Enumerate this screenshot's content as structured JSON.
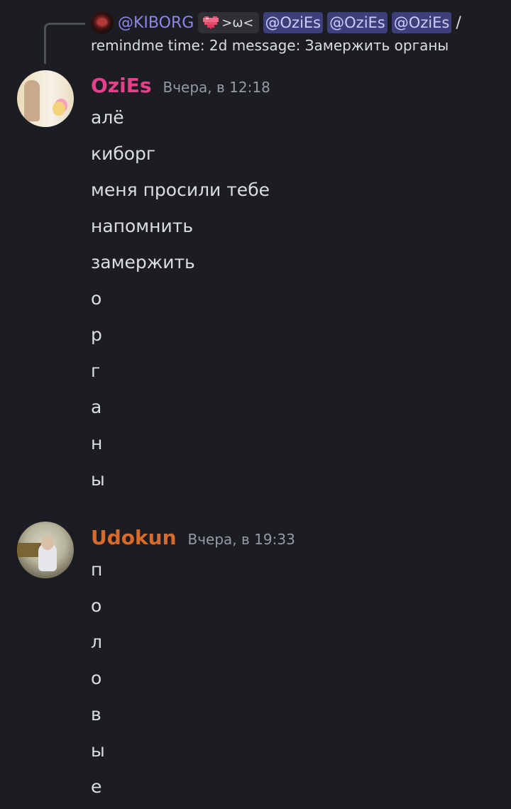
{
  "reply": {
    "author": "@KIBORG",
    "role_tag": ">ω<",
    "mentions": [
      "@OziEs",
      "@OziEs",
      "@OziEs"
    ],
    "slash": "/",
    "command_text": "remindme time: 2d message: Замержить органы"
  },
  "messages": [
    {
      "author": "OziEs",
      "author_color": "#e6408a",
      "timestamp": "Вчера, в 12:18",
      "lines": [
        "алё",
        "киборг",
        "меня просили тебе",
        "напомнить",
        "замержить",
        "о",
        "р",
        "г",
        "а",
        "н",
        "ы"
      ]
    },
    {
      "author": "Udokun",
      "author_color": "#d86a2b",
      "timestamp": "Вчера, в 19:33",
      "lines": [
        "п",
        "о",
        "л",
        "о",
        "в",
        "ы",
        "е"
      ]
    }
  ],
  "colors": {
    "background": "#1c1d22",
    "mention_bg": "#3c3f7a",
    "mention_text": "#c9cdfb",
    "reply_author": "#8b87e8",
    "timestamp": "#949ba4"
  }
}
